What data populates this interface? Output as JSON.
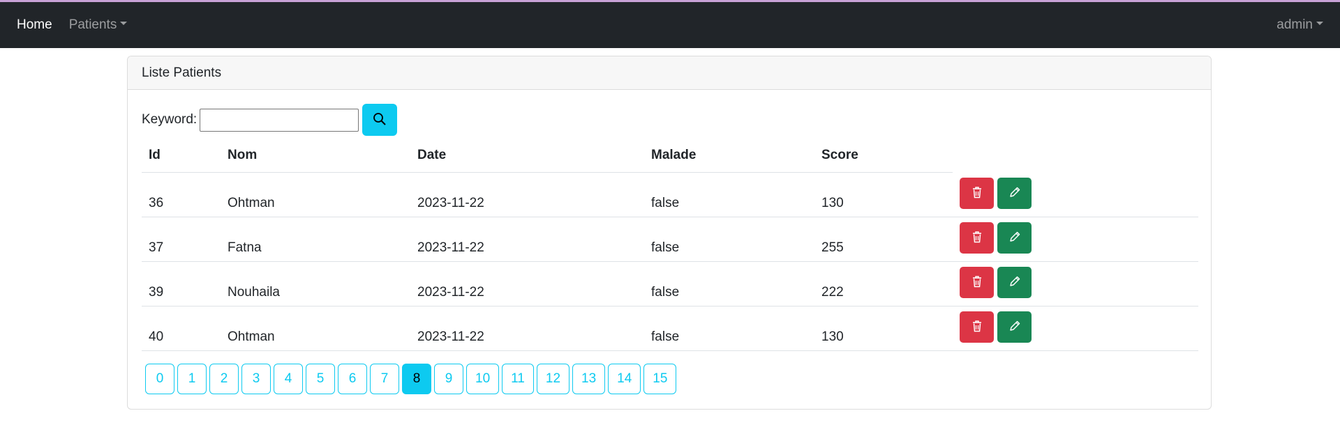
{
  "navbar": {
    "home": "Home",
    "patients": "Patients",
    "user": "admin"
  },
  "card": {
    "title": "Liste Patients"
  },
  "search": {
    "label": "Keyword:",
    "value": ""
  },
  "table": {
    "headers": [
      "Id",
      "Nom",
      "Date",
      "Malade",
      "Score"
    ],
    "rows": [
      {
        "id": "36",
        "nom": "Ohtman",
        "date": "2023-11-22",
        "malade": "false",
        "score": "130"
      },
      {
        "id": "37",
        "nom": "Fatna",
        "date": "2023-11-22",
        "malade": "false",
        "score": "255"
      },
      {
        "id": "39",
        "nom": "Nouhaila",
        "date": "2023-11-22",
        "malade": "false",
        "score": "222"
      },
      {
        "id": "40",
        "nom": "Ohtman",
        "date": "2023-11-22",
        "malade": "false",
        "score": "130"
      }
    ]
  },
  "pagination": {
    "pages": [
      "0",
      "1",
      "2",
      "3",
      "4",
      "5",
      "6",
      "7",
      "8",
      "9",
      "10",
      "11",
      "12",
      "13",
      "14",
      "15"
    ],
    "current": "8"
  },
  "colors": {
    "navbar": "#212529",
    "info": "#0dcaf0",
    "danger": "#dc3545",
    "success": "#198754"
  },
  "icons": {
    "search": "search-icon",
    "delete": "trash-icon",
    "edit": "pencil-icon"
  }
}
